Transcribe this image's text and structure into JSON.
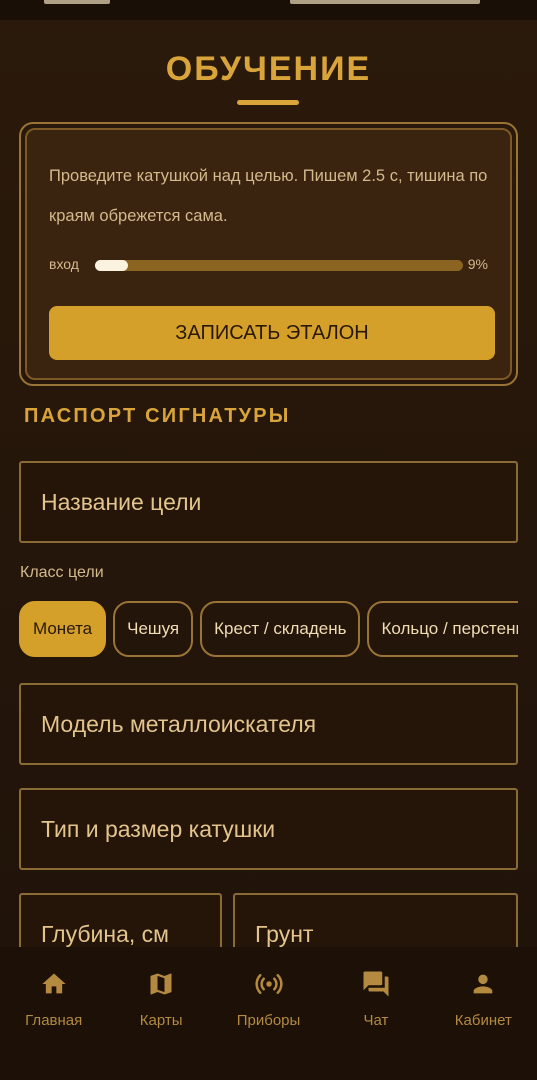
{
  "header": {
    "title": "ОБУЧЕНИЕ"
  },
  "calibration": {
    "instruction": "Проведите катушкой над целью. Пишем 2.5 с, тишина по краям обрежется сама.",
    "input_label": "вход",
    "input_level": 0.09,
    "input_level_text": "9%",
    "record_button": "ЗАПИСАТЬ ЭТАЛОН"
  },
  "passport": {
    "heading": "ПАСПОРТ СИГНАТУРЫ",
    "target_name_placeholder": "Название цели",
    "class_label": "Класс цели",
    "classes": [
      "Монета",
      "Чешуя",
      "Крест / складень",
      "Кольцо / перстень"
    ],
    "selected_class": "Монета",
    "detector_model_placeholder": "Модель металлоискателя",
    "coil_placeholder": "Тип и размер катушки",
    "depth_placeholder": "Глубина, см",
    "soil_placeholder": "Грунт"
  },
  "bottom_nav": [
    {
      "label": "Главная",
      "icon": "home-icon"
    },
    {
      "label": "Карты",
      "icon": "map-icon"
    },
    {
      "label": "Приборы",
      "icon": "radar-icon"
    },
    {
      "label": "Чат",
      "icon": "chat-icon"
    },
    {
      "label": "Кабинет",
      "icon": "person-icon"
    }
  ],
  "colors": {
    "accent": "#d9a43a",
    "button": "#d4a02a",
    "background": "#2b1a0b",
    "card": "#3a230f",
    "nav_icon": "#b38a3f"
  }
}
